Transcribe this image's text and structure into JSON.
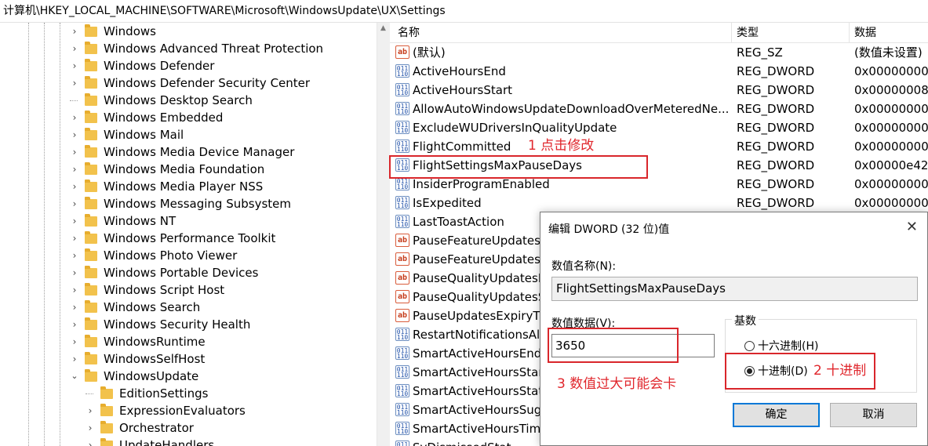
{
  "address_path": "计算机\\HKEY_LOCAL_MACHINE\\SOFTWARE\\Microsoft\\WindowsUpdate\\UX\\Settings",
  "tree": [
    {
      "label": "Windows",
      "exp": "right"
    },
    {
      "label": "Windows Advanced Threat Protection",
      "exp": "right"
    },
    {
      "label": "Windows Defender",
      "exp": "right"
    },
    {
      "label": "Windows Defender Security Center",
      "exp": "right"
    },
    {
      "label": "Windows Desktop Search",
      "exp": "none"
    },
    {
      "label": "Windows Embedded",
      "exp": "right"
    },
    {
      "label": "Windows Mail",
      "exp": "right"
    },
    {
      "label": "Windows Media Device Manager",
      "exp": "right"
    },
    {
      "label": "Windows Media Foundation",
      "exp": "right"
    },
    {
      "label": "Windows Media Player NSS",
      "exp": "right"
    },
    {
      "label": "Windows Messaging Subsystem",
      "exp": "right"
    },
    {
      "label": "Windows NT",
      "exp": "right"
    },
    {
      "label": "Windows Performance Toolkit",
      "exp": "right"
    },
    {
      "label": "Windows Photo Viewer",
      "exp": "right"
    },
    {
      "label": "Windows Portable Devices",
      "exp": "right"
    },
    {
      "label": "Windows Script Host",
      "exp": "right"
    },
    {
      "label": "Windows Search",
      "exp": "right"
    },
    {
      "label": "Windows Security Health",
      "exp": "right"
    },
    {
      "label": "WindowsRuntime",
      "exp": "right"
    },
    {
      "label": "WindowsSelfHost",
      "exp": "right"
    },
    {
      "label": "WindowsUpdate",
      "exp": "down"
    },
    {
      "label": "EditionSettings",
      "exp": "none"
    },
    {
      "label": "ExpressionEvaluators",
      "exp": "right"
    },
    {
      "label": "Orchestrator",
      "exp": "right"
    },
    {
      "label": "UpdateHandlers",
      "exp": "right"
    }
  ],
  "columns": {
    "name": "名称",
    "type": "类型",
    "data": "数据"
  },
  "values": [
    {
      "name": "(默认)",
      "type": "REG_SZ",
      "data": "(数值未设置)",
      "icon": "string-value-icon"
    },
    {
      "name": "ActiveHoursEnd",
      "type": "REG_DWORD",
      "data": "0x00000000",
      "icon": "binary-value-icon"
    },
    {
      "name": "ActiveHoursStart",
      "type": "REG_DWORD",
      "data": "0x00000008",
      "icon": "binary-value-icon"
    },
    {
      "name": "AllowAutoWindowsUpdateDownloadOverMeteredNe...",
      "type": "REG_DWORD",
      "data": "0x00000000",
      "icon": "binary-value-icon"
    },
    {
      "name": "ExcludeWUDriversInQualityUpdate",
      "type": "REG_DWORD",
      "data": "0x00000000",
      "icon": "binary-value-icon"
    },
    {
      "name": "FlightCommitted",
      "type": "REG_DWORD",
      "data": "0x00000000",
      "icon": "binary-value-icon"
    },
    {
      "name": "FlightSettingsMaxPauseDays",
      "type": "REG_DWORD",
      "data": "0x00000e42",
      "icon": "binary-value-icon"
    },
    {
      "name": "InsiderProgramEnabled",
      "type": "REG_DWORD",
      "data": "0x00000000",
      "icon": "binary-value-icon"
    },
    {
      "name": "IsExpedited",
      "type": "REG_DWORD",
      "data": "0x00000000",
      "icon": "binary-value-icon"
    },
    {
      "name": "LastToastAction",
      "type": "",
      "data": "",
      "icon": "binary-value-icon"
    },
    {
      "name": "PauseFeatureUpdatesE",
      "type": "",
      "data": "",
      "icon": "string-value-icon"
    },
    {
      "name": "PauseFeatureUpdatesS",
      "type": "",
      "data": "",
      "icon": "string-value-icon"
    },
    {
      "name": "PauseQualityUpdatesE",
      "type": "",
      "data": "",
      "icon": "string-value-icon"
    },
    {
      "name": "PauseQualityUpdatesS",
      "type": "",
      "data": "",
      "icon": "string-value-icon"
    },
    {
      "name": "PauseUpdatesExpiryTi",
      "type": "",
      "data": "",
      "icon": "string-value-icon"
    },
    {
      "name": "RestartNotificationsAll",
      "type": "",
      "data": "",
      "icon": "binary-value-icon"
    },
    {
      "name": "SmartActiveHoursEnd",
      "type": "",
      "data": "",
      "icon": "binary-value-icon"
    },
    {
      "name": "SmartActiveHoursStar",
      "type": "",
      "data": "",
      "icon": "binary-value-icon"
    },
    {
      "name": "SmartActiveHoursStat",
      "type": "",
      "data": "",
      "icon": "binary-value-icon"
    },
    {
      "name": "SmartActiveHoursSugg",
      "type": "",
      "data": "",
      "icon": "binary-value-icon"
    },
    {
      "name": "SmartActiveHoursTime",
      "type": "",
      "data": "",
      "icon": "binary-value-icon"
    },
    {
      "name": "SvDismissedStat",
      "type": "",
      "data": "",
      "icon": "binary-value-icon"
    }
  ],
  "annotations": {
    "step1": "1  点击修改",
    "step2": "2  十进制",
    "step3": "3  数值过大可能会卡"
  },
  "dialog": {
    "title": "编辑 DWORD (32 位)值",
    "close_glyph": "✕",
    "name_label": "数值名称(N):",
    "name_value": "FlightSettingsMaxPauseDays",
    "data_label": "数值数据(V):",
    "data_value": "3650",
    "base_label": "基数",
    "hex_label": "十六进制(H)",
    "dec_label": "十进制(D)",
    "selected_base": "decimal",
    "ok_label": "确定",
    "cancel_label": "取消"
  },
  "colors": {
    "annotation_red": "#e0262c",
    "focus_blue": "#0078d7"
  }
}
